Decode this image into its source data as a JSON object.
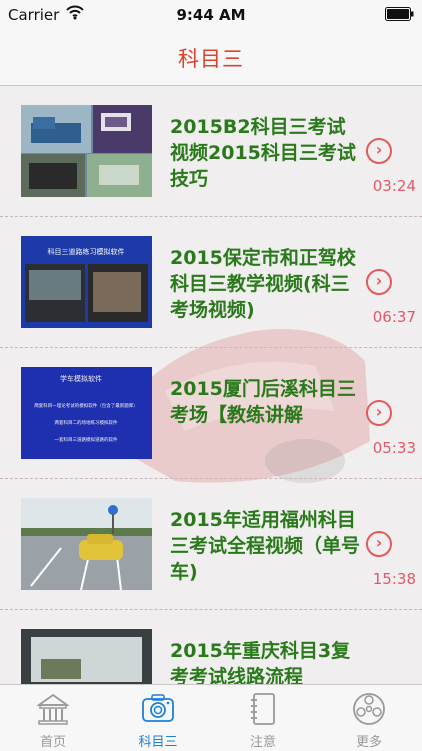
{
  "status_bar": {
    "carrier": "Carrier",
    "time": "9:44 AM"
  },
  "nav": {
    "title": "科目三"
  },
  "items": [
    {
      "title": "2015B2科目三考试视频2015科目三考试技巧",
      "duration": "03:24"
    },
    {
      "title": "2015保定市和正驾校科目三教学视频(科三考场视频)",
      "duration": "06:37"
    },
    {
      "title": "2015厦门后溪科目三考场【教练讲解",
      "duration": "05:33"
    },
    {
      "title": "2015年适用福州科目三考试全程视频（单号车)",
      "duration": "15:38"
    },
    {
      "title": "2015年重庆科目3复考考试线路流程",
      "duration": ""
    }
  ],
  "thumbs": {
    "t2": {
      "caption": "科目三道路练习模拟软件"
    },
    "t3": {
      "heading": "学车模拟软件",
      "line1": "两套科目一理论考试的模拟软件（包含了最新题库）",
      "line2": "两套科目二的场地练习模拟软件",
      "line3": "一套科目三道路模拟道路的软件"
    }
  },
  "tabs": [
    {
      "label": "首页",
      "icon": "building-icon",
      "active": false
    },
    {
      "label": "科目三",
      "icon": "camera-icon",
      "active": true
    },
    {
      "label": "注意",
      "icon": "notebook-icon",
      "active": false
    },
    {
      "label": "更多",
      "icon": "reel-icon",
      "active": false
    }
  ],
  "colors": {
    "accent": "#1d7fd6",
    "title_green": "#2a7a1c",
    "nav_title": "#d9442b",
    "duration": "#e05a6a"
  }
}
